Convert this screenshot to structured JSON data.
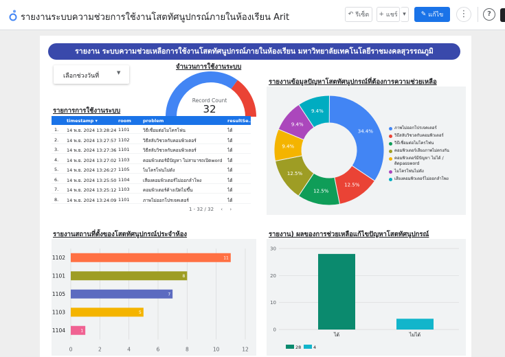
{
  "header": {
    "title": "รายงานระบบความช่วยการใช้งานโสตทัศนูปกรณ์ภายในห้องเรียน Arit",
    "undo_label": "รีเซ็ต",
    "share_label": "แชร์",
    "edit_label": "แก้ไข",
    "more_label": "⋮",
    "help_label": "?"
  },
  "banner": "รายงาน ระบบความช่วยเหลือการใช้งานโสตทัศนูปกรณ์ภายในห้องเรียน มหาวิทยาลัยเทคโนโลยีราชมงคลสุวรรณภูมิ",
  "date_picker": {
    "label": "เลือกช่วงวันที่",
    "caret": "▼"
  },
  "gauge": {
    "title": "จำนวนการใช้งานระบบ",
    "label": "Record Count",
    "value": "32",
    "fraction": 0.7,
    "colors": {
      "main": "#4285f4",
      "rest": "#ea4335"
    }
  },
  "table": {
    "title": "รายการการใช้งานระบบ",
    "columns": [
      "timestamp ▾",
      "room",
      "problem",
      "resultSe..."
    ],
    "rows": [
      {
        "no": "1.",
        "timestamp": "14 พ.ย. 2024 13:28:24",
        "room": "1101",
        "problem": "วิธีเชื่อมต่อไมโครโฟน",
        "result": "ได้"
      },
      {
        "no": "2.",
        "timestamp": "14 พ.ย. 2024 13:27:57",
        "room": "1102",
        "problem": "วิธีสลับวิชวลกับคอมพิวเตอร์",
        "result": "ได้"
      },
      {
        "no": "3.",
        "timestamp": "14 พ.ย. 2024 13:27:36",
        "room": "1101",
        "problem": "วิธีสลับวิชวลกับคอมพิวเตอร์",
        "result": "ได้"
      },
      {
        "no": "4.",
        "timestamp": "14 พ.ย. 2024 13:27:02",
        "room": "1103",
        "problem": "คอมพิวเตอร์มีปัญหา ไม่สามารถเปิดword",
        "result": "ได้"
      },
      {
        "no": "5.",
        "timestamp": "14 พ.ย. 2024 13:26:27",
        "room": "1105",
        "problem": "ไมโครโฟนไม่ดัง",
        "result": "ได้"
      },
      {
        "no": "6.",
        "timestamp": "14 พ.ย. 2024 13:25:50",
        "room": "1104",
        "problem": "เสียงคอมพิวเตอร์ไม่ออกลำโพง",
        "result": "ได้"
      },
      {
        "no": "7.",
        "timestamp": "14 พ.ย. 2024 13:25:12",
        "room": "1103",
        "problem": "คอมพิวเตอร์ค้างเปิดไม่ขึ้น",
        "result": "ได้"
      },
      {
        "no": "8.",
        "timestamp": "14 พ.ย. 2024 13:24:09",
        "room": "1101",
        "problem": "ภาพไม่ออกโปรเจคเตอร์",
        "result": "ได้"
      }
    ],
    "pager": "1 - 32 / 32",
    "prev": "‹",
    "next": "›"
  },
  "pie_title": "รายงานข้อมูลปัญหาโสตทัศนูปกรณ์ที่ต้องการความช่วยเหลือ",
  "bar_title": "รายงานสถานที่ตั้งของโสตทัศนูปกรณ์ประจำห้อง",
  "col_title": "รายงาน) ผลของการช่วยเหลือแก้ไขปัญหาโสตทัศนูปกรณ์",
  "chart_data": [
    {
      "type": "pie",
      "title": "รายงานข้อมูลปัญหาโสตทัศนูปกรณ์ที่ต้องการความช่วยเหลือ",
      "donut": true,
      "slices": [
        {
          "name": "ภาพไม่ออกโปรเจคเตอร์",
          "percent": 34.4,
          "label": "34.4%",
          "color": "#4285f4"
        },
        {
          "name": "วิธีสลับวิชวลกับคอมพิวเตอร์",
          "percent": 12.5,
          "label": "12.5%",
          "color": "#ea4335"
        },
        {
          "name": "วิธีเชื่อมต่อไมโครโฟน",
          "percent": 12.5,
          "label": "12.5%",
          "color": "#0f9d58"
        },
        {
          "name": "คอมพิวเตอร์เสียงภาพไม่ตรงกัน",
          "percent": 12.5,
          "label": "12.5%",
          "color": "#9e9d24"
        },
        {
          "name": "คอมพิวเตอร์มีปัญหา ไม่ได้ /ติดpassword",
          "percent": 9.4,
          "label": "9.4%",
          "color": "#f4b400"
        },
        {
          "name": "ไมโครโฟนไม่ดัง",
          "percent": 9.4,
          "label": "9.4%",
          "color": "#ab47bc"
        },
        {
          "name": "เสียงคอมพิวเตอร์ไม่ออกลำโพง",
          "percent": 9.4,
          "label": "9.4%",
          "color": "#00acc1"
        }
      ],
      "legend_position": "right"
    },
    {
      "type": "bar",
      "orientation": "horizontal",
      "title": "รายงานสถานที่ตั้งของโสตทัศนูปกรณ์ประจำห้อง",
      "categories": [
        "1102",
        "1101",
        "1105",
        "1103",
        "1104"
      ],
      "values": [
        11,
        8,
        7,
        5,
        1
      ],
      "colors": [
        "#ff7043",
        "#9e9d24",
        "#5c6bc0",
        "#f4b400",
        "#f06292"
      ],
      "xlim": [
        0,
        12
      ],
      "xticks": [
        "0",
        "2",
        "4",
        "6",
        "8",
        "10",
        "12"
      ],
      "grid": true
    },
    {
      "type": "bar",
      "orientation": "vertical",
      "title": "รายงาน) ผลของการช่วยเหลือแก้ไขปัญหาโสตทัศนูปกรณ์",
      "categories": [
        "ได้",
        "ไม่ได้"
      ],
      "values": [
        28,
        4
      ],
      "colors": [
        "#0b8a6e",
        "#12b5cb"
      ],
      "ylim": [
        0,
        30
      ],
      "yticks": [
        "0",
        "10",
        "20",
        "30"
      ],
      "legend": [
        "28",
        "4"
      ],
      "legend_position": "bottom-left",
      "grid": true
    }
  ]
}
